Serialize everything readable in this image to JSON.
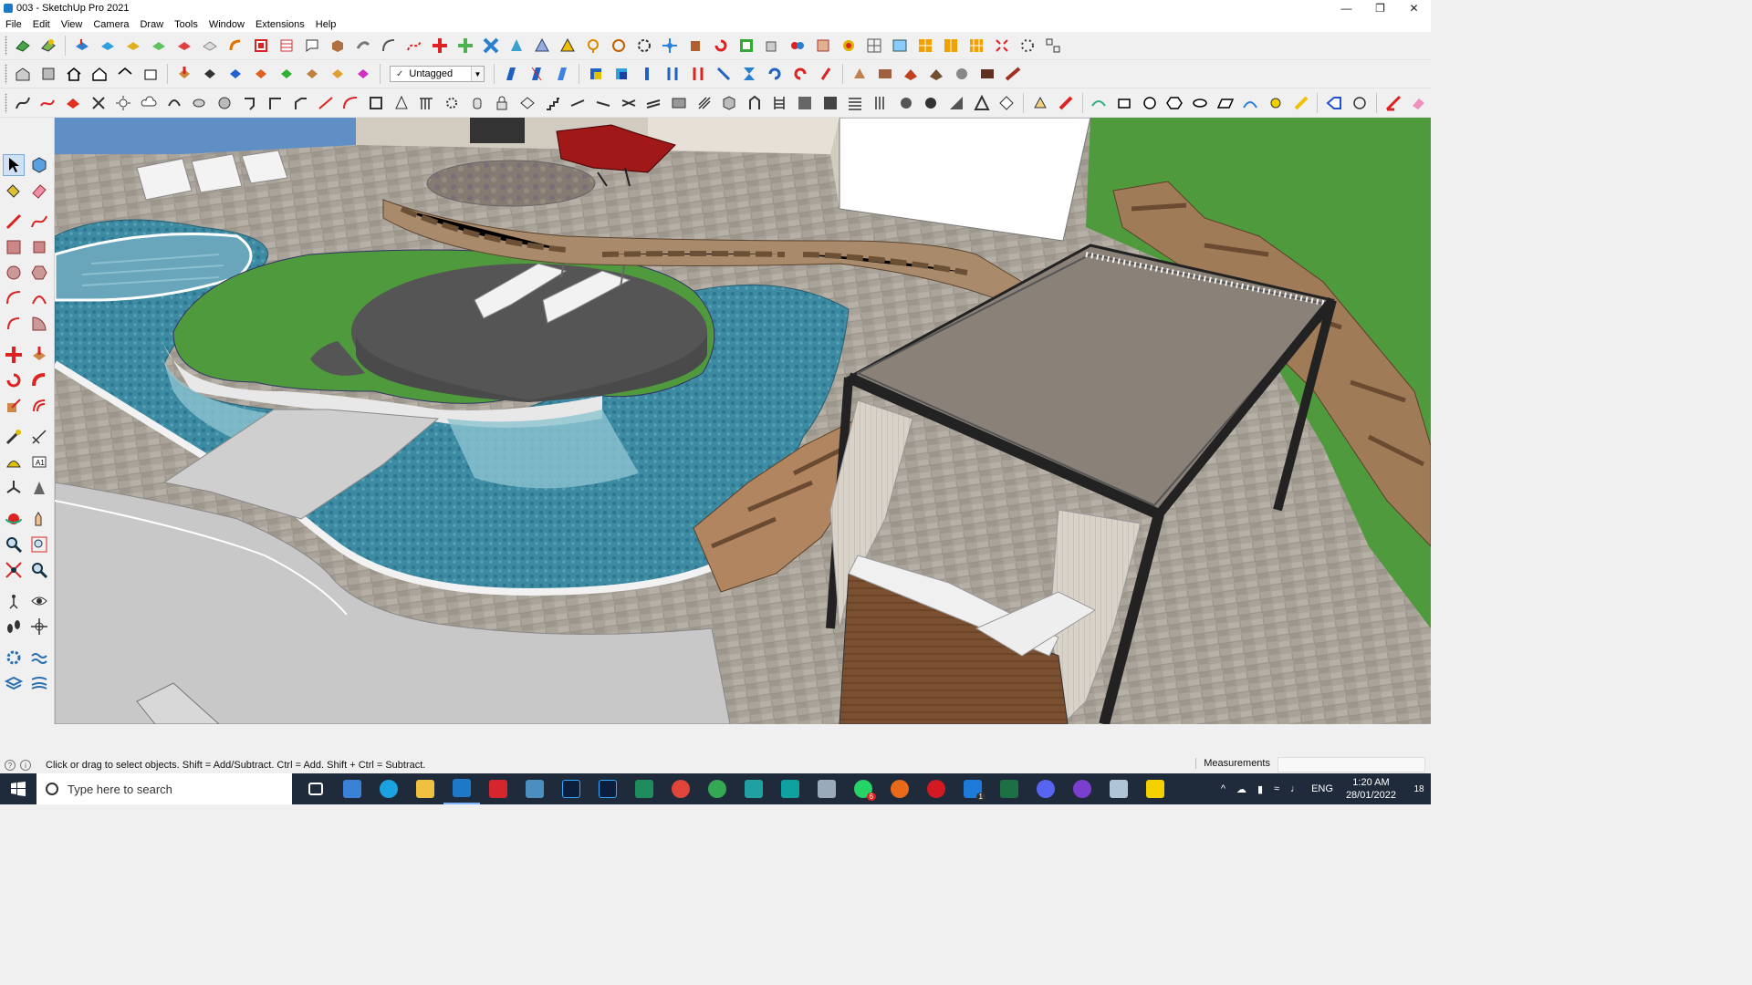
{
  "window": {
    "title": "003 - SketchUp Pro 2021",
    "controls": [
      "minimize",
      "maximize",
      "close"
    ]
  },
  "menubar": {
    "items": [
      "File",
      "Edit",
      "View",
      "Camera",
      "Draw",
      "Tools",
      "Window",
      "Extensions",
      "Help"
    ]
  },
  "toolbar": {
    "tag_value": "Untagged",
    "tag_check": "✓"
  },
  "status": {
    "hint": "Click or drag to select objects. Shift = Add/Subtract. Ctrl = Add. Shift + Ctrl = Subtract.",
    "measurements_label": "Measurements",
    "measurements_value": ""
  },
  "taskbar": {
    "search_placeholder": "Type here to search",
    "language": "ENG",
    "time": "1:20 AM",
    "date": "28/01/2022",
    "notification_count": "18",
    "badge_whatsapp": "6",
    "badge_vscode": "1"
  },
  "colors": {
    "accent": "#1e78c8",
    "taskbar": "#1f2b3a",
    "pool": "#3f8fa8",
    "grass": "#4e9a3a",
    "paving": "#a9a39a",
    "pergola_frame": "#222222",
    "canopy": "#8a8178"
  }
}
